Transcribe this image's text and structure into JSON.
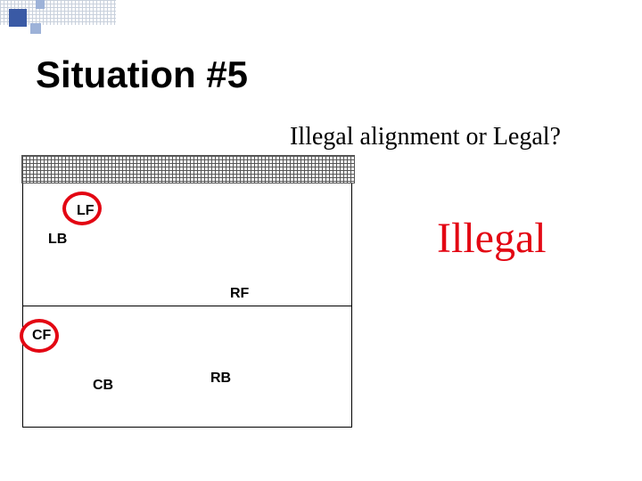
{
  "title": "Situation #5",
  "question": "Illegal alignment or Legal?",
  "verdict": "Illegal",
  "positions": {
    "lf": "LF",
    "lb": "LB",
    "rf": "RF",
    "cf": "CF",
    "cb": "CB",
    "rb": "RB"
  }
}
